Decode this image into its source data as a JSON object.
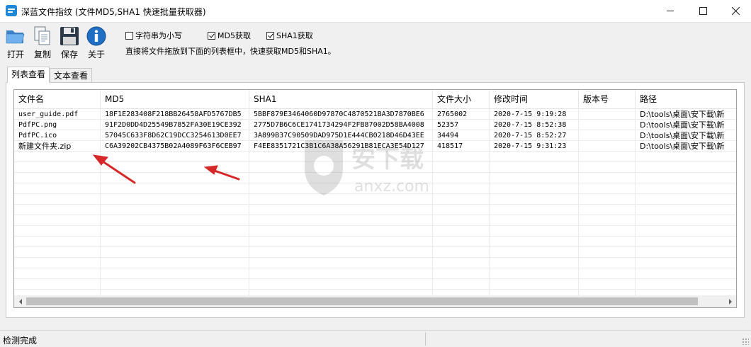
{
  "window": {
    "title": "深蓝文件指纹 (文件MD5,SHA1 快速批量获取器)",
    "minimize_glyph": "—",
    "maximize_glyph": "☐",
    "close_glyph": "✕"
  },
  "toolbar": {
    "open_label": "打开",
    "copy_label": "复制",
    "save_label": "保存",
    "about_label": "关于",
    "icons": [
      "folder-open-icon",
      "copy-icon",
      "save-icon",
      "info-icon"
    ]
  },
  "options": {
    "lowercase": {
      "label": "字符串为小写",
      "checked": false
    },
    "md5": {
      "label": "MD5获取",
      "checked": true
    },
    "sha1": {
      "label": "SHA1获取",
      "checked": true
    },
    "hint": "直接将文件拖放到下面的列表框中，快速获取MD5和SHA1。"
  },
  "tabs": [
    {
      "label": "列表查看",
      "active": true
    },
    {
      "label": "文本查看",
      "active": false
    }
  ],
  "table": {
    "columns": [
      "文件名",
      "MD5",
      "SHA1",
      "文件大小",
      "修改时间",
      "版本号",
      "路径"
    ],
    "rows": [
      [
        "user_guide.pdf",
        "18F1E283408F218BB26458AFD5767DB5",
        "5BBF879E3464060D97870C4870521BA3D7870BE6",
        "2765002",
        "2020-7-15 9:19:28",
        "",
        "D:\\tools\\桌面\\安下载\\新"
      ],
      [
        "PdfPC.png",
        "91F2D0DD4D25549B7852FA30E19CE392",
        "2775D7B6C6CE1741734294F2FB87002D58BA4008",
        "52357",
        "2020-7-15 8:52:38",
        "",
        "D:\\tools\\桌面\\安下载\\新"
      ],
      [
        "PdfPC.ico",
        "57045C633F8D62C19DCC3254613D0EE7",
        "3A899B37C90509DAD975D1E444CB0218D46D43EE",
        "34494",
        "2020-7-15 8:52:27",
        "",
        "D:\\tools\\桌面\\安下载\\新"
      ],
      [
        "新建文件夹.zip",
        "C6A39202CB4375B02A4089F63F6CEB97",
        "F4EE8351721C3B1C6A38A56291B81ECA3E54D127",
        "418517",
        "2020-7-15 9:31:23",
        "",
        "D:\\tools\\桌面\\安下载\\新"
      ]
    ]
  },
  "watermark": {
    "brand": "安下载",
    "domain": "anxz.com"
  },
  "status": {
    "text": "检测完成"
  },
  "colors": {
    "accent": "#1e88d6",
    "arrow": "#d62828",
    "header_line": "#e5e5e5"
  }
}
